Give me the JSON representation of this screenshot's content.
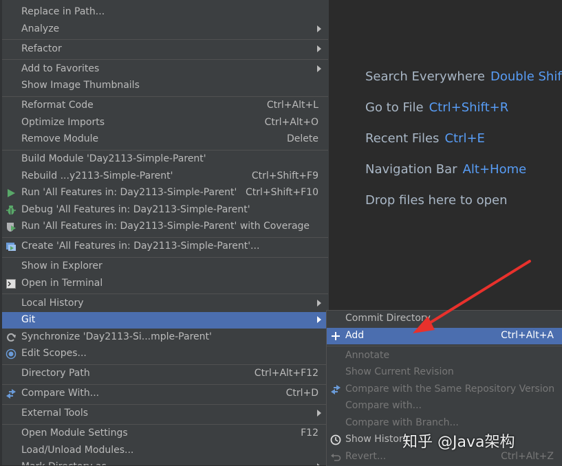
{
  "menu": {
    "items": [
      {
        "label": "Replace in Path...",
        "shortcut": "",
        "sub": false,
        "icon": "",
        "sep": false
      },
      {
        "label": "Analyze",
        "shortcut": "",
        "sub": true,
        "icon": "",
        "sep": true
      },
      {
        "label": "Refactor",
        "shortcut": "",
        "sub": true,
        "icon": "",
        "sep": true
      },
      {
        "label": "Add to Favorites",
        "shortcut": "",
        "sub": true,
        "icon": "",
        "sep": false
      },
      {
        "label": "Show Image Thumbnails",
        "shortcut": "",
        "sub": false,
        "icon": "",
        "sep": true
      },
      {
        "label": "Reformat Code",
        "shortcut": "Ctrl+Alt+L",
        "sub": false,
        "icon": "",
        "sep": false
      },
      {
        "label": "Optimize Imports",
        "shortcut": "Ctrl+Alt+O",
        "sub": false,
        "icon": "",
        "sep": false
      },
      {
        "label": "Remove Module",
        "shortcut": "Delete",
        "sub": false,
        "icon": "",
        "sep": true
      },
      {
        "label": "Build Module 'Day2113-Simple-Parent'",
        "shortcut": "",
        "sub": false,
        "icon": "",
        "sep": false
      },
      {
        "label": "Rebuild ...y2113-Simple-Parent'",
        "shortcut": "Ctrl+Shift+F9",
        "sub": false,
        "icon": "",
        "sep": false
      },
      {
        "label": "Run 'All Features in: Day2113-Simple-Parent'",
        "shortcut": "Ctrl+Shift+F10",
        "sub": false,
        "icon": "run",
        "sep": false
      },
      {
        "label": "Debug 'All Features in: Day2113-Simple-Parent'",
        "shortcut": "",
        "sub": false,
        "icon": "debug",
        "sep": false
      },
      {
        "label": "Run 'All Features in: Day2113-Simple-Parent' with Coverage",
        "shortcut": "",
        "sub": false,
        "icon": "coverage",
        "sep": true
      },
      {
        "label": "Create 'All Features in: Day2113-Simple-Parent'...",
        "shortcut": "",
        "sub": false,
        "icon": "create",
        "sep": true
      },
      {
        "label": "Show in Explorer",
        "shortcut": "",
        "sub": false,
        "icon": "",
        "sep": false
      },
      {
        "label": "Open in Terminal",
        "shortcut": "",
        "sub": false,
        "icon": "terminal",
        "sep": true
      },
      {
        "label": "Local History",
        "shortcut": "",
        "sub": true,
        "icon": "",
        "sep": false
      },
      {
        "label": "Git",
        "shortcut": "",
        "sub": true,
        "icon": "",
        "sep": false,
        "selected": true
      },
      {
        "label": "Synchronize 'Day2113-Si...mple-Parent'",
        "shortcut": "",
        "sub": false,
        "icon": "sync",
        "sep": false
      },
      {
        "label": "Edit Scopes...",
        "shortcut": "",
        "sub": false,
        "icon": "scope",
        "sep": true
      },
      {
        "label": "Directory Path",
        "shortcut": "Ctrl+Alt+F12",
        "sub": false,
        "icon": "",
        "sep": true
      },
      {
        "label": "Compare With...",
        "shortcut": "Ctrl+D",
        "sub": false,
        "icon": "compare",
        "sep": true
      },
      {
        "label": "External Tools",
        "shortcut": "",
        "sub": true,
        "icon": "",
        "sep": true
      },
      {
        "label": "Open Module Settings",
        "shortcut": "F12",
        "sub": false,
        "icon": "",
        "sep": false
      },
      {
        "label": "Load/Unload Modules...",
        "shortcut": "",
        "sub": false,
        "icon": "",
        "sep": false
      },
      {
        "label": "Mark Directory as",
        "shortcut": "",
        "sub": true,
        "icon": "",
        "sep": false
      }
    ]
  },
  "hints": [
    {
      "text": "Search Everywhere",
      "key": "Double Shift"
    },
    {
      "text": "Go to File",
      "key": "Ctrl+Shift+R"
    },
    {
      "text": "Recent Files",
      "key": "Ctrl+E"
    },
    {
      "text": "Navigation Bar",
      "key": "Alt+Home"
    },
    {
      "text": "Drop files here to open",
      "key": ""
    }
  ],
  "git_menu": {
    "items": [
      {
        "label": "Commit Directory",
        "shortcut": "",
        "icon": "",
        "disabled": false,
        "sep": false
      },
      {
        "label": "Add",
        "shortcut": "Ctrl+Alt+A",
        "icon": "plus",
        "disabled": false,
        "selected": true,
        "sep": true
      },
      {
        "label": "Annotate",
        "shortcut": "",
        "icon": "",
        "disabled": true,
        "sep": false
      },
      {
        "label": "Show Current Revision",
        "shortcut": "",
        "icon": "",
        "disabled": true,
        "sep": false
      },
      {
        "label": "Compare with the Same Repository Version",
        "shortcut": "",
        "icon": "compare",
        "disabled": true,
        "sep": false
      },
      {
        "label": "Compare with...",
        "shortcut": "",
        "icon": "",
        "disabled": true,
        "sep": false
      },
      {
        "label": "Compare with Branch...",
        "shortcut": "",
        "icon": "",
        "disabled": true,
        "sep": false
      },
      {
        "label": "Show History",
        "shortcut": "",
        "icon": "clock",
        "disabled": false,
        "sep": false
      },
      {
        "label": "Revert...",
        "shortcut": "Ctrl+Alt+Z",
        "icon": "revert",
        "disabled": true,
        "sep": false
      }
    ]
  },
  "watermark": {
    "text": "知乎 @Java架构"
  },
  "colors": {
    "selection": "#4b6eaf",
    "menu_bg": "#3c3f41",
    "hint_key": "#589df6",
    "arrow": "#e8312c"
  }
}
